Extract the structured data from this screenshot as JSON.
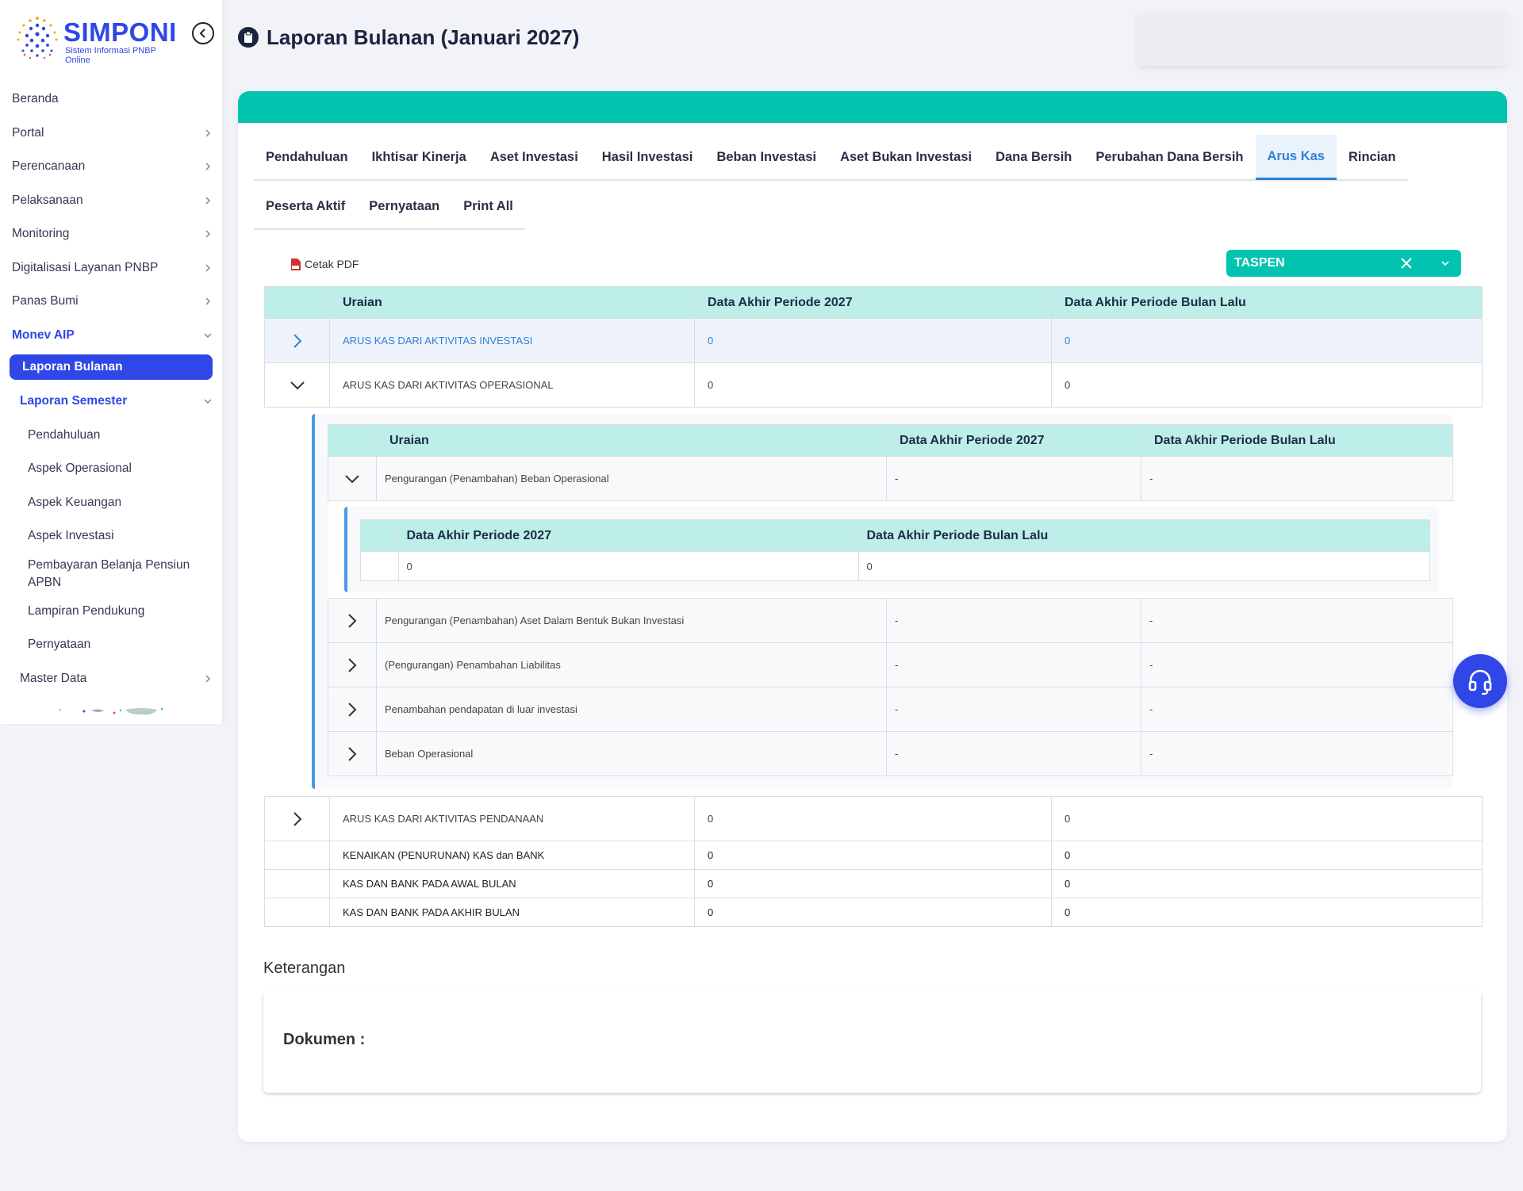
{
  "brand": {
    "name": "SIMPONI",
    "subtitle": "Sistem Informasi PNBP Online"
  },
  "sidebar": {
    "items": [
      {
        "label": "Beranda"
      },
      {
        "label": "Portal"
      },
      {
        "label": "Perencanaan"
      },
      {
        "label": "Pelaksanaan"
      },
      {
        "label": "Monitoring"
      },
      {
        "label": "Digitalisasi Layanan PNBP"
      },
      {
        "label": "Panas Bumi"
      },
      {
        "label": "Monev AIP"
      },
      {
        "label": "Laporan Bulanan"
      },
      {
        "label": "Laporan Semester"
      },
      {
        "label": "Pendahuluan"
      },
      {
        "label": "Aspek Operasional"
      },
      {
        "label": "Aspek Keuangan"
      },
      {
        "label": "Aspek Investasi"
      },
      {
        "label": "Pembayaran Belanja Pensiun APBN"
      },
      {
        "label": "Lampiran Pendukung"
      },
      {
        "label": "Pernyataan"
      },
      {
        "label": "Master Data"
      }
    ]
  },
  "header": {
    "title": "Laporan Bulanan (Januari 2027)"
  },
  "tabs": {
    "row1": [
      "Pendahuluan",
      "Ikhtisar Kinerja",
      "Aset Investasi",
      "Hasil Investasi",
      "Beban Investasi",
      "Aset Bukan Investasi",
      "Dana Bersih",
      "Perubahan Dana Bersih",
      "Arus Kas",
      "Rincian"
    ],
    "row2": [
      "Peserta Aktif",
      "Pernyataan",
      "Print All"
    ],
    "active": "Arus Kas"
  },
  "toolbar": {
    "cetak_label": "Cetak PDF",
    "select_value": "TASPEN"
  },
  "main_table": {
    "headers": [
      "Uraian",
      "Data Akhir Periode 2027",
      "Data Akhir Periode Bulan Lalu"
    ],
    "rows": [
      {
        "uraian": "ARUS KAS DARI AKTIVITAS INVESTASI",
        "current": "0",
        "previous": "0"
      },
      {
        "uraian": "ARUS KAS DARI AKTIVITAS OPERASIONAL",
        "current": "0",
        "previous": "0"
      },
      {
        "uraian": "ARUS KAS DARI AKTIVITAS PENDANAAN",
        "current": "0",
        "previous": "0"
      },
      {
        "uraian": "KENAIKAN (PENURUNAN) KAS dan BANK",
        "current": "0",
        "previous": "0"
      },
      {
        "uraian": "KAS DAN BANK PADA AWAL BULAN",
        "current": "0",
        "previous": "0"
      },
      {
        "uraian": "KAS DAN BANK PADA AKHIR BULAN",
        "current": "0",
        "previous": "0"
      }
    ]
  },
  "nested_table": {
    "headers": [
      "Uraian",
      "Data Akhir Periode 2027",
      "Data Akhir Periode Bulan Lalu"
    ],
    "rows": [
      {
        "uraian": "Pengurangan (Penambahan) Beban Operasional",
        "current": "-",
        "previous": "-"
      },
      {
        "uraian": "Pengurangan (Penambahan) Aset Dalam Bentuk Bukan Investasi",
        "current": "-",
        "previous": "-"
      },
      {
        "uraian": "(Pengurangan) Penambahan Liabilitas",
        "current": "-",
        "previous": "-"
      },
      {
        "uraian": "Penambahan pendapatan di luar investasi",
        "current": "-",
        "previous": "-"
      },
      {
        "uraian": "Beban Operasional",
        "current": "-",
        "previous": "-"
      }
    ]
  },
  "inner_table": {
    "headers": [
      "Data Akhir Periode 2027",
      "Data Akhir Periode Bulan Lalu"
    ],
    "row": {
      "current": "0",
      "previous": "0"
    }
  },
  "keterangan": {
    "title": "Keterangan",
    "dokumen_label": "Dokumen :"
  },
  "colors": {
    "brand": "#2f47e6",
    "teal": "#00c4b0",
    "header_cell": "#bdeee8",
    "link": "#2f80d8"
  }
}
